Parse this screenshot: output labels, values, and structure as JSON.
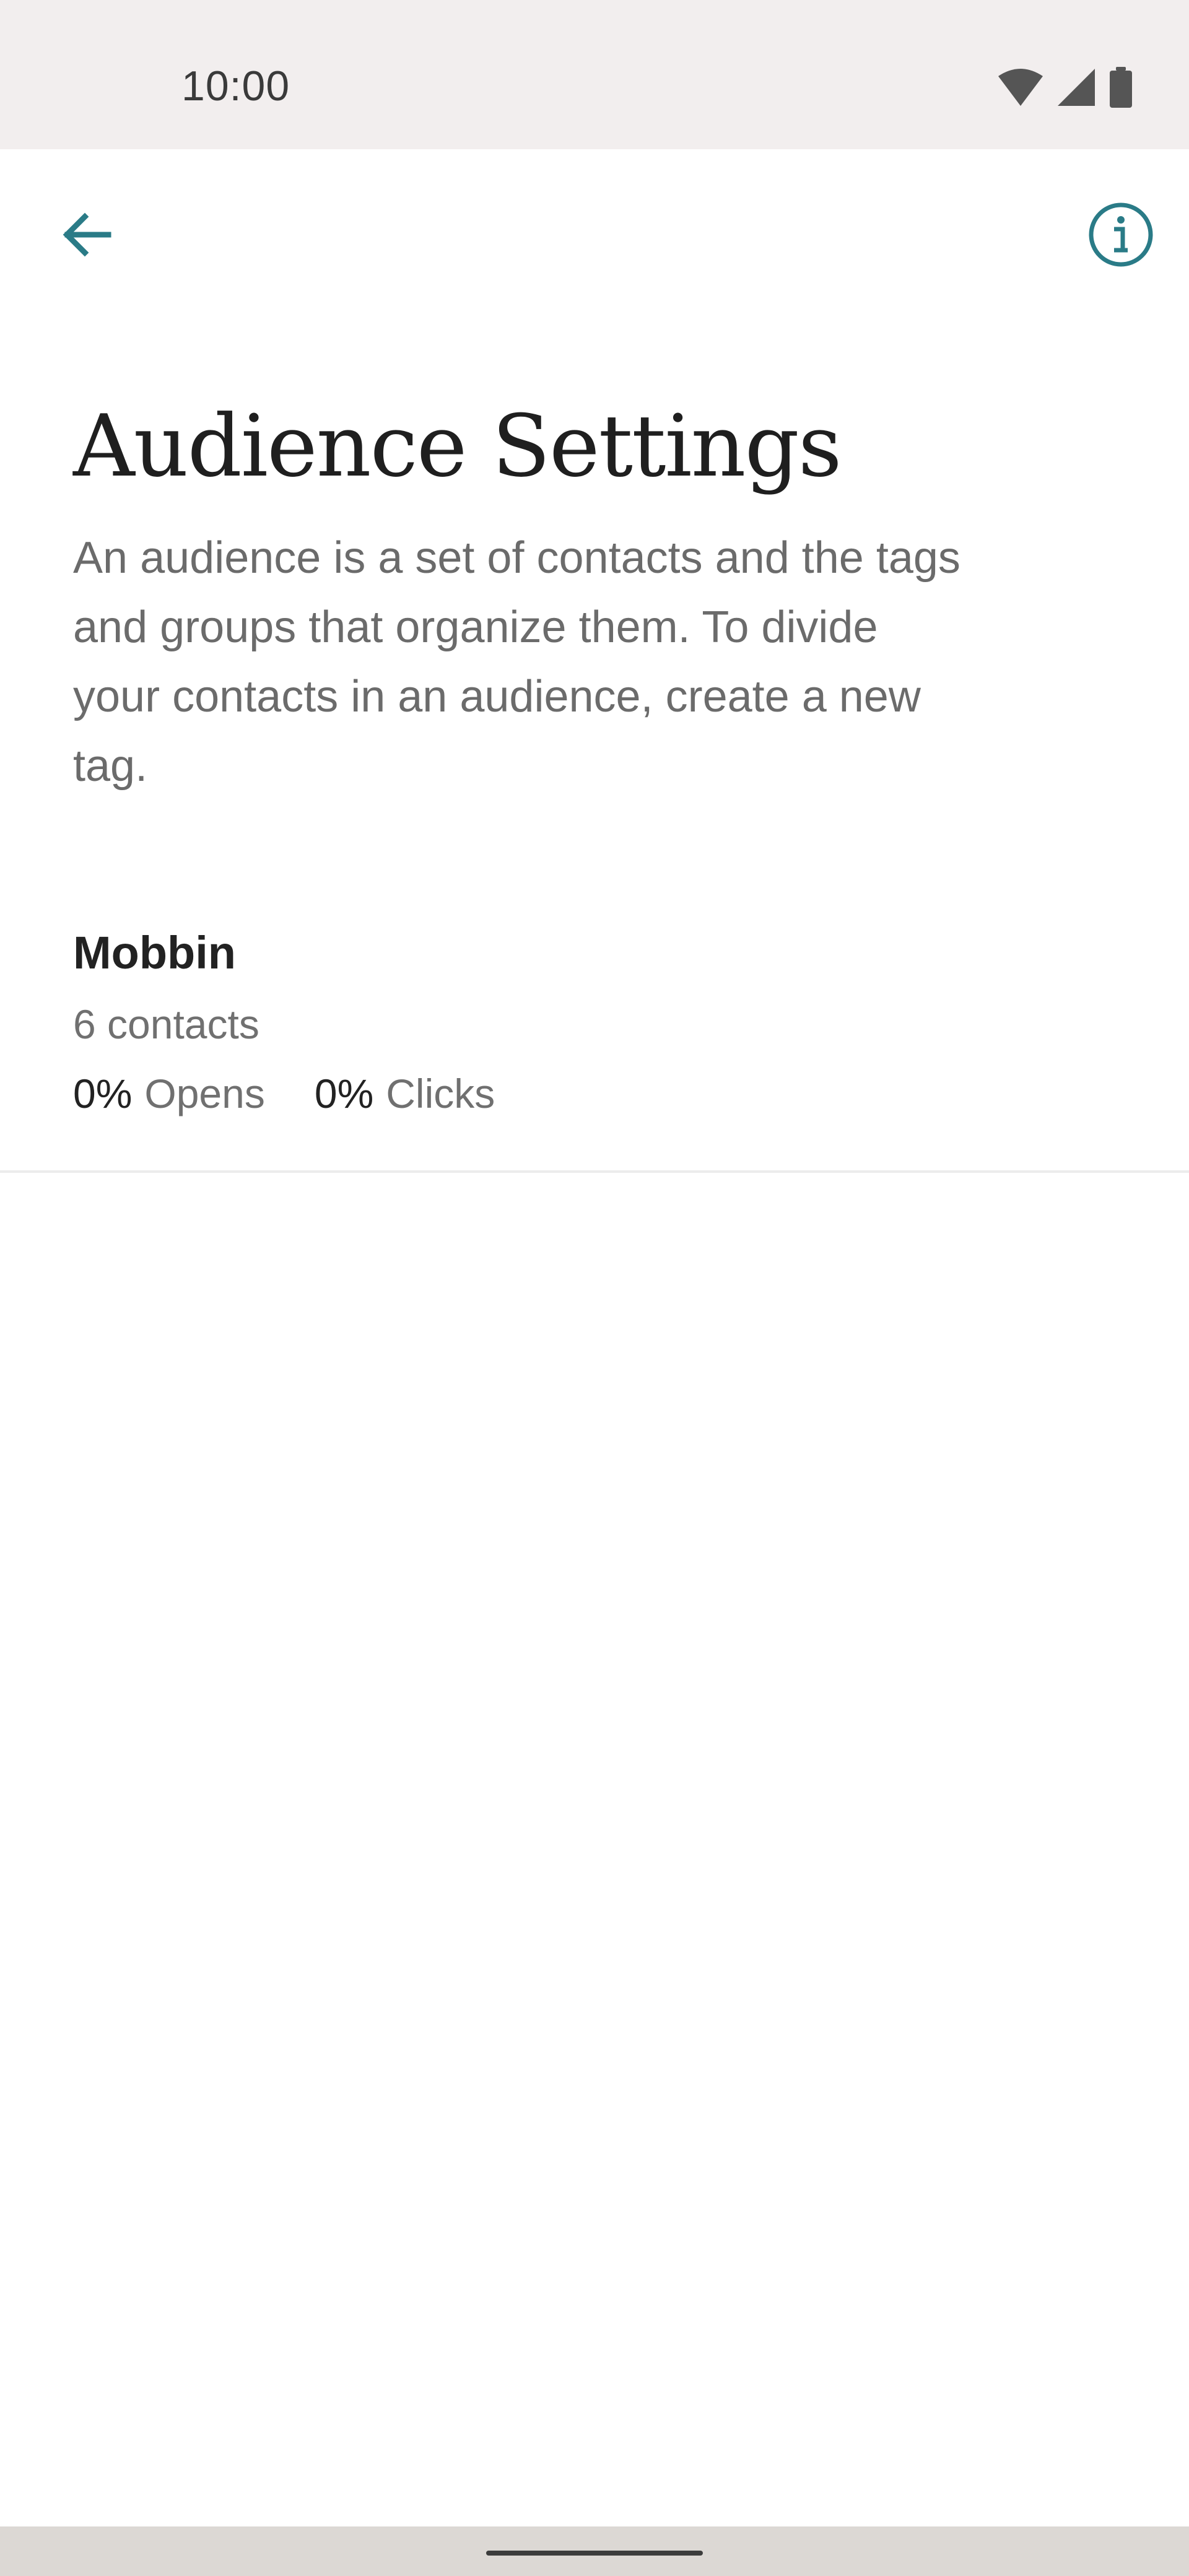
{
  "status_bar": {
    "time": "10:00",
    "icons": [
      "wifi-icon",
      "cellular-signal-icon",
      "battery-icon"
    ]
  },
  "app_bar": {
    "back_icon": "arrow-left-icon",
    "info_icon": "info-circle-icon",
    "accent_color": "#2a7b87"
  },
  "page": {
    "title": "Audience Settings",
    "description": "An audience is a set of contacts and the tags and groups that organize them. To divide your contacts in an audience, create a new tag."
  },
  "audiences": [
    {
      "name": "Mobbin",
      "contacts": "6 contacts",
      "opens_value": "0%",
      "opens_label": "Opens",
      "clicks_value": "0%",
      "clicks_label": "Clicks"
    }
  ]
}
